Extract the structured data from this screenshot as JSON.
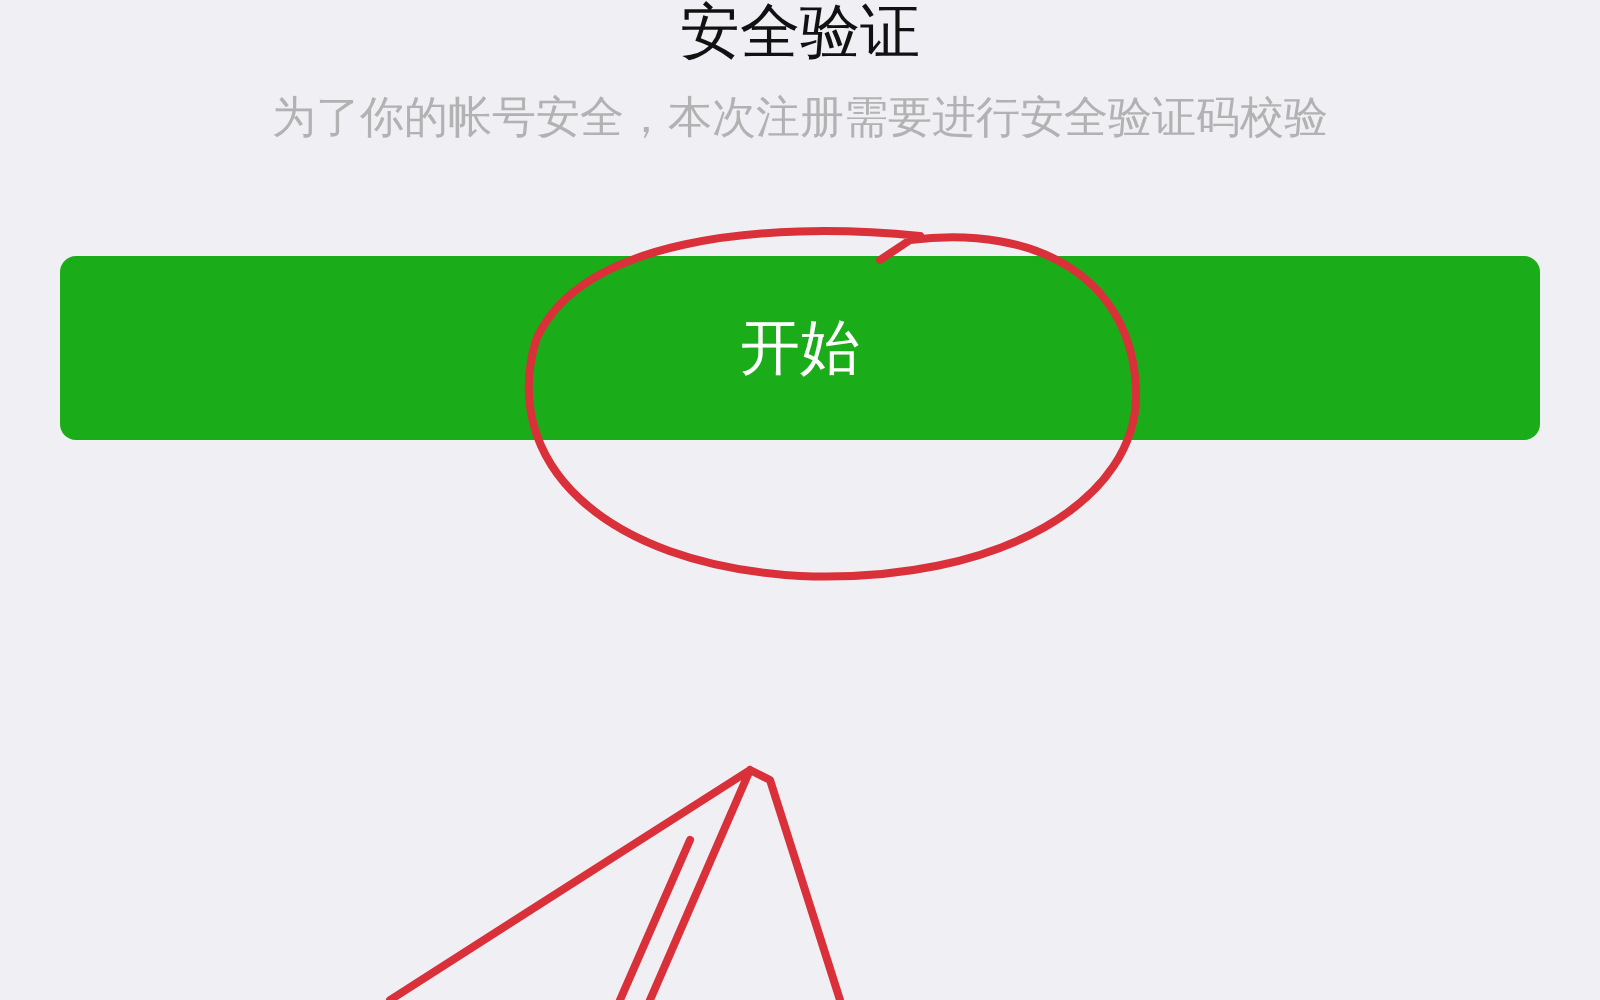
{
  "title": "安全验证",
  "description": "为了你的帐号安全，本次注册需要进行安全验证码校验",
  "start_button": {
    "label": "开始"
  }
}
